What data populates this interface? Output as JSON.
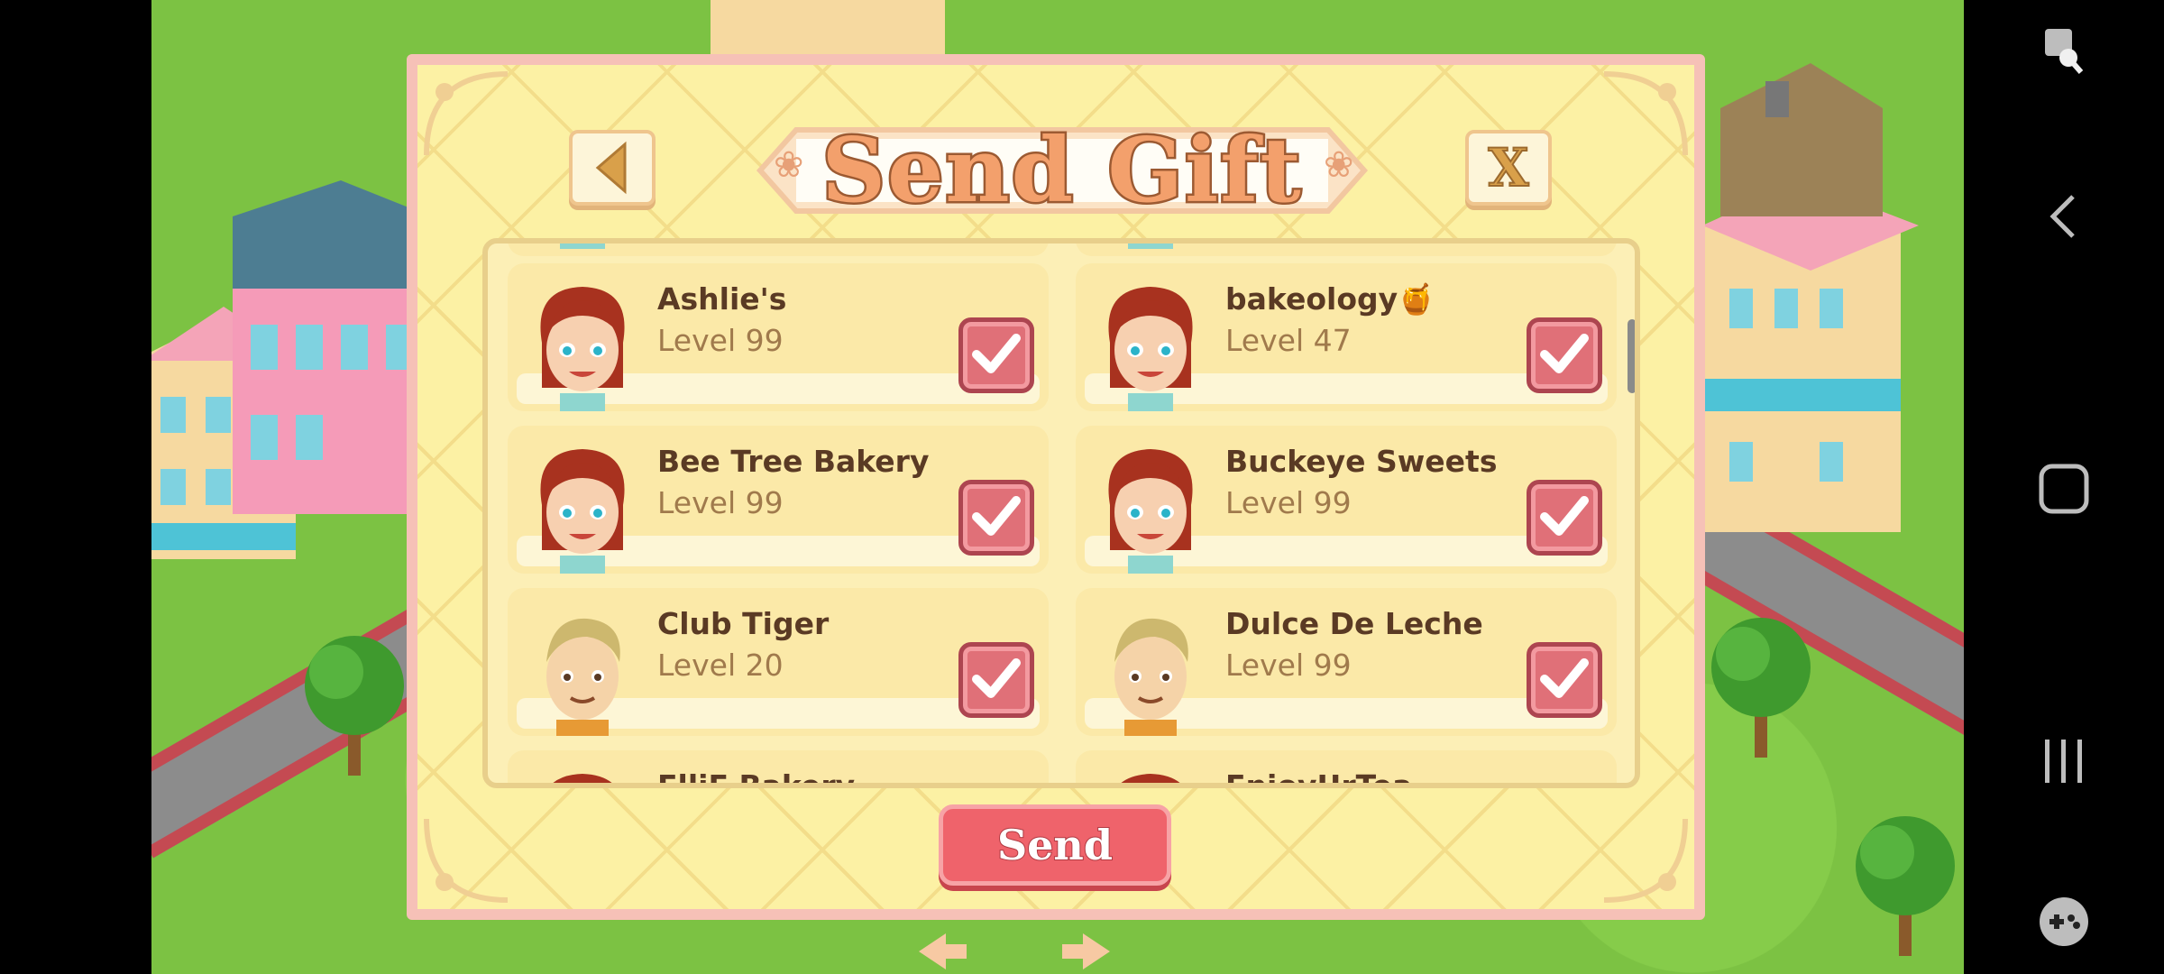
{
  "dialog": {
    "title": "Send Gift",
    "back_icon": "back-triangle-icon",
    "close_label": "X",
    "send_label": "Send"
  },
  "friends": [
    {
      "name": "Ashlie's",
      "level": "Level 99",
      "avatar": "girl-avatar",
      "checked": true
    },
    {
      "name": "bakeology🍯",
      "level": "Level 47",
      "avatar": "girl-avatar",
      "checked": true
    },
    {
      "name": "Bee Tree Bakery",
      "level": "Level 99",
      "avatar": "girl-avatar",
      "checked": true
    },
    {
      "name": "Buckeye Sweets",
      "level": "Level 99",
      "avatar": "girl-avatar",
      "checked": true
    },
    {
      "name": "Club Tiger",
      "level": "Level 20",
      "avatar": "boy-avatar",
      "checked": true
    },
    {
      "name": "Dulce De Leche",
      "level": "Level 99",
      "avatar": "boy-avatar",
      "checked": true
    },
    {
      "name": "ElliE Bakery",
      "level": "",
      "avatar": "girl-avatar",
      "checked": true
    },
    {
      "name": "EnjoyUrTea",
      "level": "",
      "avatar": "girl-avatar",
      "checked": true
    }
  ],
  "navbar": {
    "icons": [
      "screenshot-edit-icon",
      "back-icon",
      "home-icon",
      "recents-icon",
      "game-tools-icon"
    ]
  },
  "colors": {
    "dialog_bg": "#fcf1a4",
    "dialog_border": "#f6c1b7",
    "checkbox": "#e07078",
    "send_button": "#ef636b",
    "grass": "#7cc243"
  }
}
